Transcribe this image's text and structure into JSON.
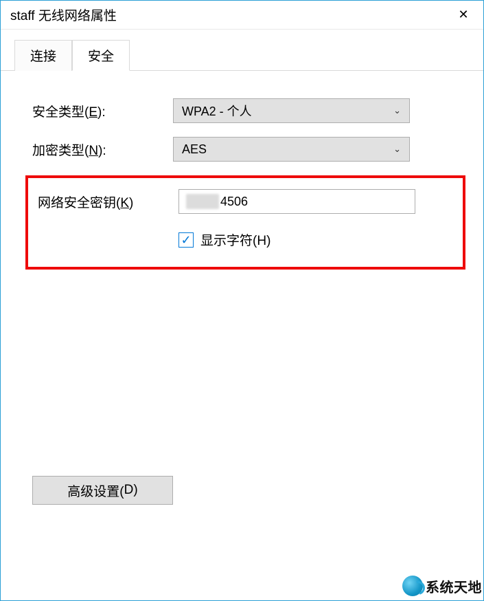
{
  "window": {
    "title": "staff 无线网络属性",
    "close_icon": "✕"
  },
  "tabs": {
    "connection": "连接",
    "security": "安全"
  },
  "form": {
    "security_type_label_pre": "安全类型(",
    "security_type_hotkey": "E",
    "security_type_label_post": "):",
    "security_type_value": "WPA2 - 个人",
    "encryption_label_pre": "加密类型(",
    "encryption_hotkey": "N",
    "encryption_label_post": "):",
    "encryption_value": "AES",
    "key_label_pre": "网络安全密钥(",
    "key_hotkey": "K",
    "key_label_post": ")",
    "key_value_visible": "4506",
    "show_chars_pre": "显示字符(",
    "show_chars_hotkey": "H",
    "show_chars_post": ")",
    "show_chars_checked": true
  },
  "advanced": {
    "label_pre": "高级设置(",
    "label_hotkey": "D",
    "label_post": ")"
  },
  "watermark": {
    "text": "系统天地"
  }
}
